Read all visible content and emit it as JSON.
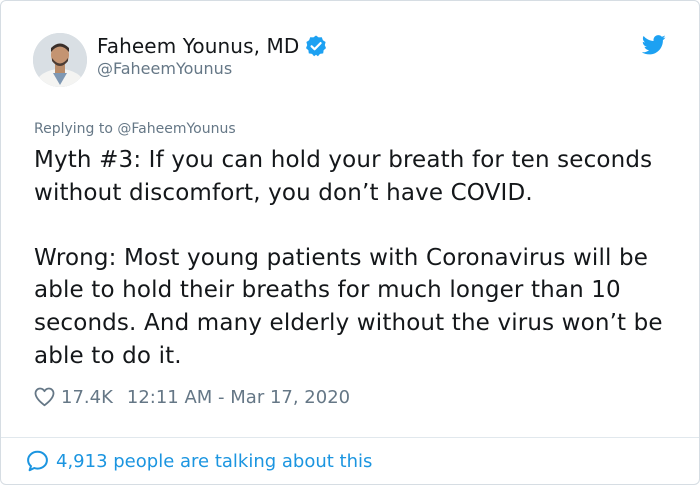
{
  "author": {
    "display_name": "Faheem Younus, MD",
    "handle": "@FaheemYounus",
    "avatar_icon": "person-in-white-coat-avatar",
    "verified_icon": "verified-badge-icon"
  },
  "platform": {
    "logo_icon": "twitter-bird-icon",
    "accent_color": "#1da1f2"
  },
  "tweet": {
    "reply_prefix": "Replying to",
    "reply_handle": "@FaheemYounus",
    "paragraphs": [
      "Myth #3: If you can hold your breath for ten seconds without discomfort, you don’t have COVID.",
      "Wrong: Most young patients with Coronavirus will be able to hold their breaths for much longer than 10 seconds. And many elderly without the virus won’t be able to do it."
    ],
    "like_count": "17.4K",
    "timestamp": "12:11 AM - Mar 17, 2020"
  },
  "footer": {
    "talking_text": "4,913 people are talking about this"
  }
}
